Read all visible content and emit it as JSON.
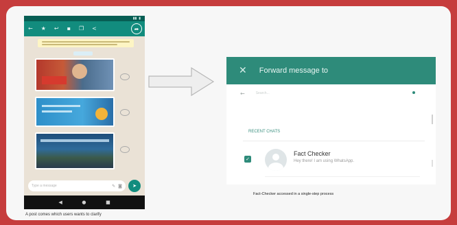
{
  "phone": {
    "status_bar": {
      "signal": "▮▮",
      "battery": "▮"
    },
    "app_bar": {
      "icons": [
        "back-arrow-icon",
        "star-icon",
        "reply-icon",
        "delete-icon",
        "copy-icon",
        "share-icon",
        "forward-icon"
      ],
      "back_glyph": "←",
      "star_glyph": "★",
      "reply_glyph": "↩",
      "delete_glyph": "▪",
      "copy_glyph": "❐",
      "share_glyph": "<",
      "forward_glyph": "➦"
    },
    "input": {
      "placeholder": "Type a message",
      "attach_glyph": "✎",
      "camera_glyph": "◙",
      "send_glyph": "➤"
    },
    "nav": {
      "back_glyph": "◀",
      "home_glyph": "●",
      "recents_glyph": "■"
    }
  },
  "left_caption": "A post comes which users wants to clarify",
  "dialog": {
    "title": "Forward message to",
    "close_glyph": "✕",
    "back_glyph": "←",
    "search_placeholder": "Search...",
    "section_label": "RECENT CHATS",
    "chat": {
      "name": "Fact Checker",
      "status": "Hey there! I am using WhatsApp.",
      "checked": true,
      "check_glyph": "✓"
    }
  },
  "right_caption": "Fact-Checker accessed in a single-step process",
  "colors": {
    "border": "#c63d3d",
    "whatsapp_teal": "#2e8b7a",
    "whatsapp_dark": "#075e54"
  }
}
